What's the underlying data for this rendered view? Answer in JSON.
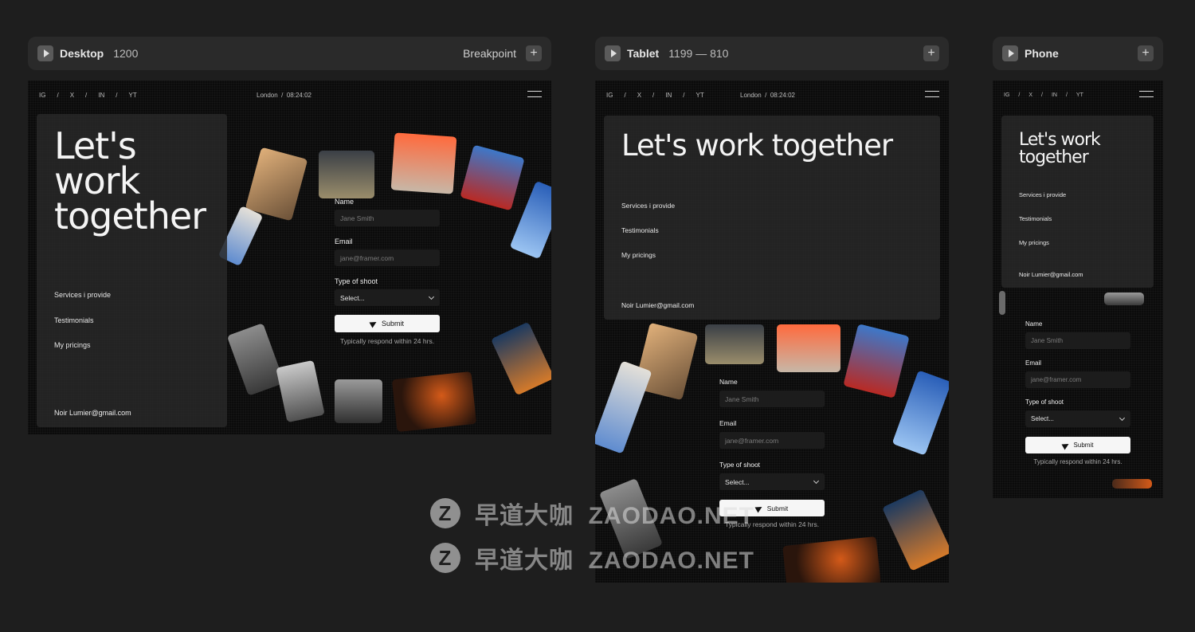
{
  "desktop": {
    "bar": {
      "title": "Desktop",
      "size": "1200",
      "breakpoint": "Breakpoint",
      "plus": "+"
    },
    "nav": {
      "social": [
        "IG",
        "/",
        "X",
        "/",
        "IN",
        "/",
        "YT"
      ],
      "city": "London",
      "sep": "/",
      "time": "08:24:02"
    },
    "heading": [
      "Let's",
      "work",
      "together"
    ],
    "links": [
      "Services i provide",
      "Testimonials",
      "My pricings"
    ],
    "email": "Noir Lumier@gmail.com",
    "form": {
      "name_label": "Name",
      "name_placeholder": "Jane Smith",
      "email_label": "Email",
      "email_placeholder": "jane@framer.com",
      "type_label": "Type of shoot",
      "type_value": "Select...",
      "submit": "Submit",
      "note": "Typically respond within 24 hrs."
    }
  },
  "tablet": {
    "bar": {
      "title": "Tablet",
      "size": "1199 — 810",
      "plus": "+"
    },
    "nav": {
      "social": [
        "IG",
        "/",
        "X",
        "/",
        "IN",
        "/",
        "YT"
      ],
      "city": "London",
      "sep": "/",
      "time": "08:24:02"
    },
    "heading": "Let's work together",
    "links": [
      "Services i provide",
      "Testimonials",
      "My pricings"
    ],
    "email": "Noir Lumier@gmail.com",
    "form": {
      "name_label": "Name",
      "name_placeholder": "Jane Smith",
      "email_label": "Email",
      "email_placeholder": "jane@framer.com",
      "type_label": "Type of shoot",
      "type_value": "Select...",
      "submit": "Submit",
      "note": "Typically respond within 24 hrs."
    }
  },
  "phone": {
    "bar": {
      "title": "Phone",
      "plus": "+"
    },
    "nav": {
      "social": [
        "IG",
        "/",
        "X",
        "/",
        "IN",
        "/",
        "YT"
      ]
    },
    "heading": [
      "Let's work",
      "together"
    ],
    "links": [
      "Services i provide",
      "Testimonials",
      "My pricings"
    ],
    "email": "Noir Lumier@gmail.com",
    "form": {
      "name_label": "Name",
      "name_placeholder": "Jane Smith",
      "email_label": "Email",
      "email_placeholder": "jane@framer.com",
      "type_label": "Type of shoot",
      "type_value": "Select...",
      "submit": "Submit",
      "note": "Typically respond within 24 hrs."
    }
  },
  "watermark": {
    "icon": "Z",
    "text": "早道大咖  ZAODAO.NET"
  },
  "colors": {
    "canvas": "#1e1e1e",
    "bar": "#2a2a2a",
    "frame": "#0b0b0b",
    "card": "#282828",
    "button": "#f6f6f6"
  }
}
